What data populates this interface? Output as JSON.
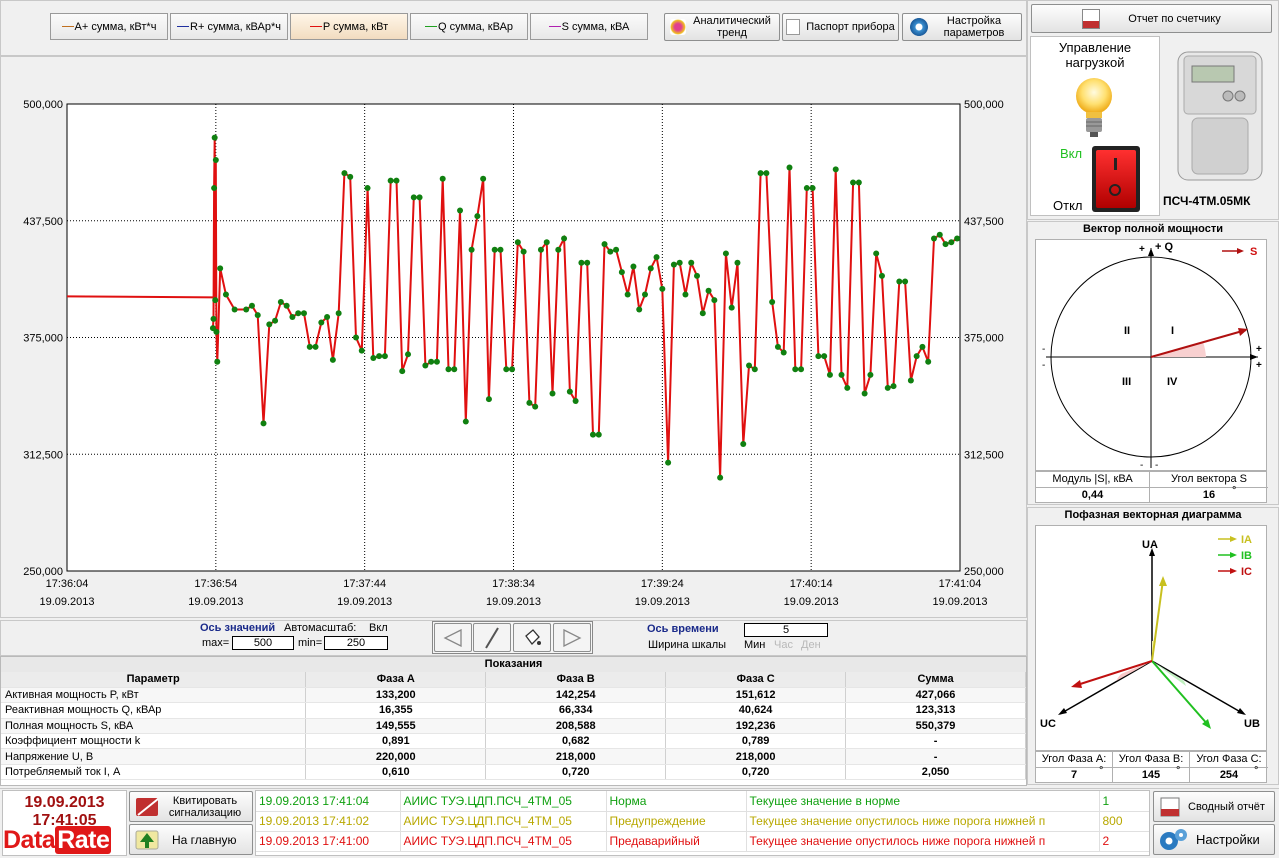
{
  "legend": [
    {
      "label": "A+ сумма, кВт*ч",
      "color": "#c07020",
      "active": false
    },
    {
      "label": "R+ сумма, кВАр*ч",
      "color": "#2030a0",
      "active": false
    },
    {
      "label": "P сумма, кВт",
      "color": "#e01010",
      "active": true
    },
    {
      "label": "Q сумма, кВАр",
      "color": "#20a020",
      "active": false
    },
    {
      "label": "S сумма, кВА",
      "color": "#b020b0",
      "active": false
    }
  ],
  "toolbar": {
    "analytic_trend": "Аналитический тренд",
    "passport": "Паспорт прибора",
    "settings_params": "Настройка параметров",
    "report_meter": "Отчет по счетчику"
  },
  "load_control": {
    "title": "Управление нагрузкой",
    "on": "Вкл",
    "off": "Откл"
  },
  "device": {
    "name": "ПСЧ-4ТМ.05МК"
  },
  "chart_data": {
    "type": "line",
    "series": [
      {
        "name": "P сумма, кВт",
        "color": "#e01010"
      }
    ],
    "yticks": [
      "500,000",
      "437,500",
      "375,000",
      "312,500",
      "250,000"
    ],
    "ylim": [
      250,
      500
    ],
    "xticks": [
      {
        "time": "17:36:04",
        "date": "19.09.2013"
      },
      {
        "time": "17:36:54",
        "date": "19.09.2013"
      },
      {
        "time": "17:37:44",
        "date": "19.09.2013"
      },
      {
        "time": "17:38:34",
        "date": "19.09.2013"
      },
      {
        "time": "17:39:24",
        "date": "19.09.2013"
      },
      {
        "time": "17:40:14",
        "date": "19.09.2013"
      },
      {
        "time": "17:41:04",
        "date": "19.09.2013"
      }
    ],
    "flat_segment": [
      [
        0,
        397
      ],
      [
        50.5,
        396.5
      ]
    ],
    "points": [
      [
        50.5,
        380
      ],
      [
        50.7,
        385
      ],
      [
        50.9,
        455
      ],
      [
        51.1,
        482
      ],
      [
        51.3,
        395
      ],
      [
        51.5,
        470
      ],
      [
        51.7,
        378
      ],
      [
        52,
        362
      ],
      [
        53,
        412
      ],
      [
        55,
        398
      ],
      [
        58,
        390
      ],
      [
        62,
        390
      ],
      [
        64,
        392
      ],
      [
        66,
        387
      ],
      [
        68,
        329
      ],
      [
        70,
        382
      ],
      [
        72,
        384
      ],
      [
        74,
        394
      ],
      [
        76,
        392
      ],
      [
        78,
        386
      ],
      [
        80,
        388
      ],
      [
        82,
        388
      ],
      [
        84,
        370
      ],
      [
        86,
        370
      ],
      [
        88,
        383
      ],
      [
        90,
        386
      ],
      [
        92,
        363
      ],
      [
        94,
        388
      ],
      [
        96,
        463
      ],
      [
        98,
        461
      ],
      [
        100,
        375
      ],
      [
        102,
        368
      ],
      [
        104,
        455
      ],
      [
        106,
        364
      ],
      [
        108,
        365
      ],
      [
        110,
        365
      ],
      [
        112,
        459
      ],
      [
        114,
        459
      ],
      [
        116,
        357
      ],
      [
        118,
        366
      ],
      [
        120,
        450
      ],
      [
        122,
        450
      ],
      [
        124,
        360
      ],
      [
        126,
        362
      ],
      [
        128,
        362
      ],
      [
        130,
        460
      ],
      [
        132,
        358
      ],
      [
        134,
        358
      ],
      [
        136,
        443
      ],
      [
        138,
        330
      ],
      [
        140,
        422
      ],
      [
        142,
        440
      ],
      [
        144,
        460
      ],
      [
        146,
        342
      ],
      [
        148,
        422
      ],
      [
        150,
        422
      ],
      [
        152,
        358
      ],
      [
        154,
        358
      ],
      [
        156,
        426
      ],
      [
        158,
        421
      ],
      [
        160,
        340
      ],
      [
        162,
        338
      ],
      [
        164,
        422
      ],
      [
        166,
        426
      ],
      [
        168,
        345
      ],
      [
        170,
        422
      ],
      [
        172,
        428
      ],
      [
        174,
        346
      ],
      [
        176,
        341
      ],
      [
        178,
        415
      ],
      [
        180,
        415
      ],
      [
        182,
        323
      ],
      [
        184,
        323
      ],
      [
        186,
        425
      ],
      [
        188,
        421
      ],
      [
        190,
        422
      ],
      [
        192,
        410
      ],
      [
        194,
        398
      ],
      [
        196,
        413
      ],
      [
        198,
        390
      ],
      [
        200,
        398
      ],
      [
        202,
        412
      ],
      [
        204,
        418
      ],
      [
        206,
        401
      ],
      [
        208,
        308
      ],
      [
        210,
        414
      ],
      [
        212,
        415
      ],
      [
        214,
        398
      ],
      [
        216,
        415
      ],
      [
        218,
        408
      ],
      [
        220,
        388
      ],
      [
        222,
        400
      ],
      [
        224,
        395
      ],
      [
        226,
        300
      ],
      [
        228,
        420
      ],
      [
        230,
        391
      ],
      [
        232,
        415
      ],
      [
        234,
        318
      ],
      [
        236,
        360
      ],
      [
        238,
        358
      ],
      [
        240,
        463
      ],
      [
        242,
        463
      ],
      [
        244,
        394
      ],
      [
        246,
        370
      ],
      [
        248,
        367
      ],
      [
        250,
        466
      ],
      [
        252,
        358
      ],
      [
        254,
        358
      ],
      [
        256,
        455
      ],
      [
        258,
        455
      ],
      [
        260,
        365
      ],
      [
        262,
        365
      ],
      [
        264,
        355
      ],
      [
        266,
        465
      ],
      [
        268,
        355
      ],
      [
        270,
        348
      ],
      [
        272,
        458
      ],
      [
        274,
        458
      ],
      [
        276,
        345
      ],
      [
        278,
        355
      ],
      [
        280,
        420
      ],
      [
        282,
        408
      ],
      [
        284,
        348
      ],
      [
        286,
        349
      ],
      [
        288,
        405
      ],
      [
        290,
        405
      ],
      [
        292,
        352
      ],
      [
        294,
        365
      ],
      [
        296,
        370
      ],
      [
        298,
        362
      ],
      [
        300,
        428
      ],
      [
        302,
        430
      ],
      [
        304,
        425
      ],
      [
        306,
        426
      ],
      [
        308,
        428
      ]
    ],
    "xmax": 309
  },
  "axis_values": {
    "title": "Ось значений",
    "autoscale": "Автомасштаб:",
    "autoscale_val": "Вкл",
    "max_label": "max=",
    "max_val": "500",
    "min_label": "min=",
    "min_val": "250"
  },
  "axis_time": {
    "title": "Ось времени",
    "scale_label": "Ширина шкалы",
    "scale_val": "5",
    "units": [
      "Мин",
      "Час",
      "Ден"
    ]
  },
  "readings": {
    "title": "Показания",
    "headers": [
      "Параметр",
      "Фаза А",
      "Фаза В",
      "Фаза С",
      "Сумма"
    ],
    "rows": [
      [
        "Активная мощность P, кВт",
        "133,200",
        "142,254",
        "151,612",
        "427,066"
      ],
      [
        "Реактивная мощность Q, кВАр",
        "16,355",
        "66,334",
        "40,624",
        "123,313"
      ],
      [
        "Полная мощность S, кВА",
        "149,555",
        "208,588",
        "192,236",
        "550,379"
      ],
      [
        "Коэффициент мощности k",
        "0,891",
        "0,682",
        "0,789",
        "-"
      ],
      [
        "Напряжение U, В",
        "220,000",
        "218,000",
        "218,000",
        "-"
      ],
      [
        "Потребляемый ток I, А",
        "0,610",
        "0,720",
        "0,720",
        "2,050"
      ]
    ]
  },
  "vector_power": {
    "title": "Вектор полной мощности",
    "legend": "S",
    "axis_q": "+ Q",
    "axis_plus": "+",
    "axis_minus": "-",
    "quadrants": [
      "I",
      "II",
      "III",
      "IV"
    ],
    "label_mod": "Модуль |S|, кВА",
    "label_angle": "Угол вектора S",
    "mod_val": "0,44",
    "angle_val": "16",
    "deg": "°"
  },
  "phase_diagram": {
    "title": "Пофазная векторная диаграмма",
    "legend": [
      {
        "label": "IA",
        "color": "#c8c020"
      },
      {
        "label": "IB",
        "color": "#20c020"
      },
      {
        "label": "IC",
        "color": "#c01010"
      }
    ],
    "ua": "UA",
    "ub": "UB",
    "uc": "UC",
    "angles": [
      {
        "label": "Угол Фаза А:",
        "val": "7"
      },
      {
        "label": "Угол Фаза В:",
        "val": "145"
      },
      {
        "label": "Угол Фаза С:",
        "val": "254"
      }
    ],
    "deg": "°"
  },
  "status": {
    "date": "19.09.2013",
    "time": "17:41:05",
    "logo1": "Data",
    "logo2": "Rate",
    "ack_label": "Квитировать сигнализацию",
    "home_label": "На главную",
    "summary_report": "Сводный отчёт",
    "settings": "Настройки"
  },
  "events": [
    {
      "time": "19.09.2013 17:41:04",
      "source": "АИИС ТУЭ.ЦДП.ПСЧ_4ТМ_05",
      "level": "Норма",
      "msg": "Текущее значение в норме",
      "code": "1",
      "color": "#10a010"
    },
    {
      "time": "19.09.2013 17:41:02",
      "source": "АИИС ТУЭ.ЦДП.ПСЧ_4ТМ_05",
      "level": "Предупреждение",
      "msg": "Текущее значение опустилось ниже порога нижней п",
      "code": "800",
      "color": "#b8a800"
    },
    {
      "time": "19.09.2013 17:41:00",
      "source": "АИИС ТУЭ.ЦДП.ПСЧ_4ТМ_05",
      "level": "Предаварийный",
      "msg": "Текущее значение опустилось ниже порога нижней п",
      "code": "2",
      "color": "#e01010"
    }
  ]
}
